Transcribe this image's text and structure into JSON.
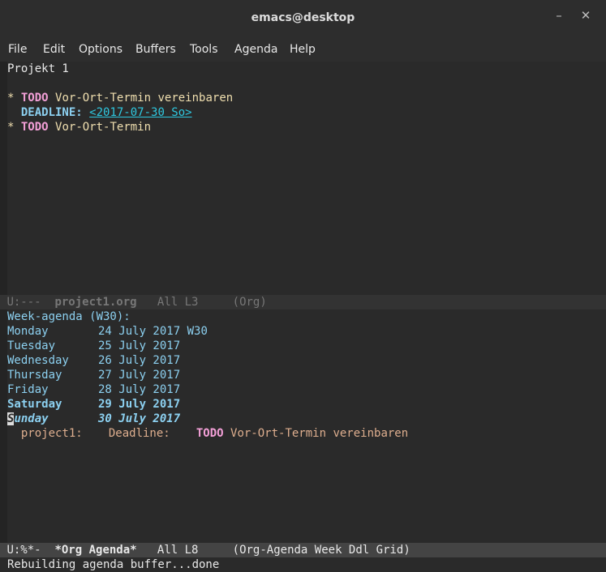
{
  "window": {
    "title": "emacs@desktop",
    "minimize_label": "–",
    "close_label": "✕"
  },
  "menu": [
    "File",
    "Edit",
    "Options",
    "Buffers",
    "Tools",
    "Agenda",
    "Help"
  ],
  "org_buffer": {
    "heading": "Projekt 1",
    "item1": {
      "star": "*",
      "keyword": "TODO",
      "title": "Vor-Ort-Termin vereinbaren"
    },
    "deadline_label": "DEADLINE:",
    "deadline_value": "<2017-07-30 So>",
    "item2": {
      "star": "*",
      "keyword": "TODO",
      "title": "Vor-Ort-Termin"
    }
  },
  "modeline1": {
    "status": "U:---",
    "buffer": "project1.org",
    "pos": "All L3",
    "mode": "(Org)"
  },
  "agenda": {
    "header": "Week-agenda (W30):",
    "days": [
      {
        "name": "Monday",
        "date": "24 July 2017",
        "week": "W30"
      },
      {
        "name": "Tuesday",
        "date": "25 July 2017"
      },
      {
        "name": "Wednesday",
        "date": "26 July 2017"
      },
      {
        "name": "Thursday",
        "date": "27 July 2017"
      },
      {
        "name": "Friday",
        "date": "28 July 2017"
      },
      {
        "name": "Saturday",
        "date": "29 July 2017"
      },
      {
        "name_first": "S",
        "name_rest": "unday",
        "date": "30 July 2017"
      }
    ],
    "entry": {
      "category": "project1:",
      "type": "Deadline:",
      "keyword": "TODO",
      "title": "Vor-Ort-Termin vereinbaren"
    }
  },
  "modeline2": {
    "status": "U:%*-",
    "buffer": "*Org Agenda*",
    "pos": "All L8",
    "mode": "(Org-Agenda Week Ddl Grid)"
  },
  "minibuffer": "Rebuilding agenda buffer...done",
  "colors": {
    "todo": "#f4a0d8",
    "agenda_day": "#8cd0f0",
    "timestamp": "#2ec8e0",
    "heading": "#f0dfaf"
  }
}
